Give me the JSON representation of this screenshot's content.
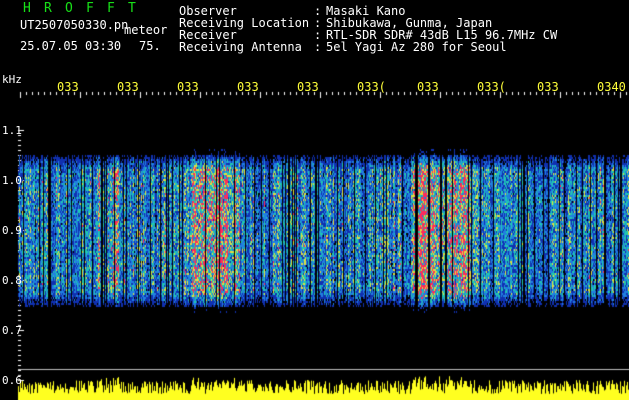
{
  "header": {
    "brand_letters": [
      "H",
      "R",
      "O",
      "F",
      "F",
      "T"
    ],
    "filename": "UT2507050330.pn",
    "meteor_label": "meteor",
    "datetime": "25.07.05 03:30",
    "meteor_count": "75.",
    "brand_color": "#18e018"
  },
  "station": {
    "rows": [
      {
        "key": "Observer",
        "value": "Masaki Kano"
      },
      {
        "key": "Receiving Location",
        "value": "Shibukawa, Gunma, Japan"
      },
      {
        "key": "Receiver",
        "value": "RTL-SDR SDR# 43dB L15 96.7MHz CW"
      },
      {
        "key": "Receiving Antenna",
        "value": "5el Yagi Az 280 for Seoul"
      }
    ]
  },
  "spectrogram": {
    "unit_label": "kHz",
    "freq_ticks": [
      {
        "label": "1.1",
        "value": 1.1
      },
      {
        "label": "1.0",
        "value": 1.0
      },
      {
        "label": "0.9",
        "value": 0.9
      },
      {
        "label": "0.8",
        "value": 0.8
      },
      {
        "label": "0.7",
        "value": 0.7
      },
      {
        "label": "0.6",
        "value": 0.6
      }
    ],
    "time_labels": [
      "033",
      "033",
      "033",
      "033",
      "033",
      "033(",
      "033",
      "033(",
      "033",
      "0340"
    ],
    "signal_band_khz": [
      0.75,
      1.05
    ],
    "colors": {
      "background": "#000000",
      "low": "#1030c8",
      "mid": "#18c8a0",
      "high": "#ff2040",
      "level": "#ffff20"
    }
  }
}
